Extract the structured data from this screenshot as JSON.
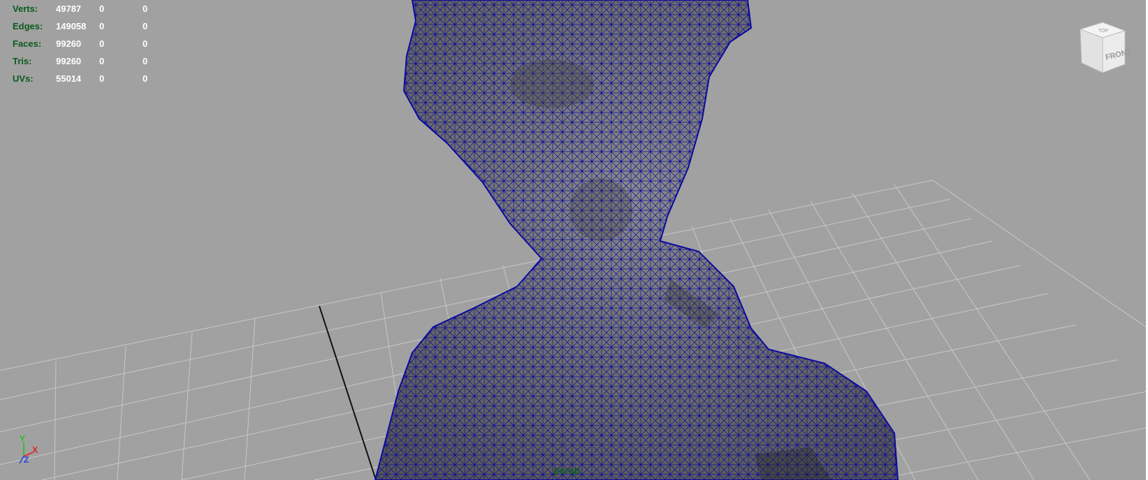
{
  "hud": {
    "rows": [
      {
        "label": "Verts:",
        "v1": "49787",
        "v2": "0",
        "v3": "0"
      },
      {
        "label": "Edges:",
        "v1": "149058",
        "v2": "0",
        "v3": "0"
      },
      {
        "label": "Faces:",
        "v1": "99260",
        "v2": "0",
        "v3": "0"
      },
      {
        "label": "Tris:",
        "v1": "99260",
        "v2": "0",
        "v3": "0"
      },
      {
        "label": "UVs:",
        "v1": "55014",
        "v2": "0",
        "v3": "0"
      }
    ]
  },
  "camera": {
    "name": "persp"
  },
  "viewcube": {
    "top_label": "TOP",
    "front_label": "FRONT"
  },
  "axes": {
    "y": "Y",
    "x": "X",
    "z": "Z"
  },
  "colors": {
    "background": "#a1a1a1",
    "grid": "#c8c8c8",
    "wireframe": "#0a0aa0",
    "hud_label": "#0b5a1b",
    "hud_value": "#ffffff",
    "axis_x": "#e02020",
    "axis_y": "#20c020",
    "axis_z": "#2040e0"
  }
}
